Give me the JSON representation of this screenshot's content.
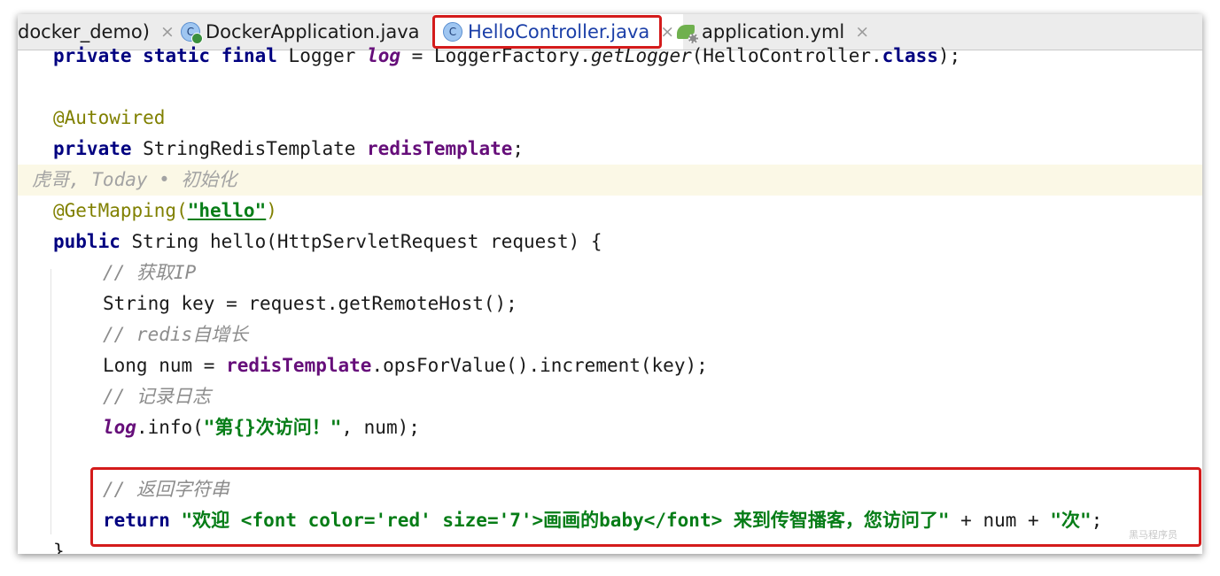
{
  "tabs": [
    {
      "label": "docker_demo)",
      "icon": "",
      "active": false
    },
    {
      "label": "DockerApplication.java",
      "icon": "java-class-run-icon",
      "active": false
    },
    {
      "label": "HelloController.java",
      "icon": "java-class-icon",
      "active": true
    },
    {
      "label": "application.yml",
      "icon": "spring-config-icon",
      "active": false
    }
  ],
  "tab_close_glyph": "×",
  "class_icon_letter": "C",
  "code": {
    "l1": [
      "private",
      " ",
      "static",
      " ",
      "final",
      " Logger ",
      "log",
      " = LoggerFactory.",
      "getLogger",
      "(HelloController.",
      "class",
      ");"
    ],
    "l2": [
      "@Autowired"
    ],
    "l3": [
      "private",
      " StringRedisTemplate ",
      "redisTemplate",
      ";"
    ],
    "blame": "虎哥, Today • 初始化",
    "l4": [
      "@GetMapping(",
      "\"hello\"",
      ")"
    ],
    "l5": [
      "public",
      " String hello(HttpServletRequest request) {"
    ],
    "l6": [
      "// 获取IP"
    ],
    "l7": [
      "String key = request.getRemoteHost();"
    ],
    "l8": [
      "// redis自增长"
    ],
    "l9": [
      "Long num = ",
      "redisTemplate",
      ".opsForValue().increment(key);"
    ],
    "l10": [
      "// 记录日志"
    ],
    "l11": [
      "log",
      ".info(",
      "\"第{}次访问！\"",
      ", num);"
    ],
    "l12": [
      "// 返回字符串"
    ],
    "l13": [
      "return",
      " ",
      "\"欢迎 <font color='red' size='7'>画画的baby</font> 来到传智播客，您访问了\"",
      " + num + ",
      "\"次\"",
      ";"
    ],
    "l14": [
      "}"
    ]
  },
  "watermark": "黑马程序员",
  "colors": {
    "keyword": "#000080",
    "annotation": "#808000",
    "string": "#067d17",
    "field": "#660e7a",
    "comment": "#8c8c8c",
    "highlight_box": "#d41b1b",
    "active_tab_text": "#1b3fa8"
  }
}
